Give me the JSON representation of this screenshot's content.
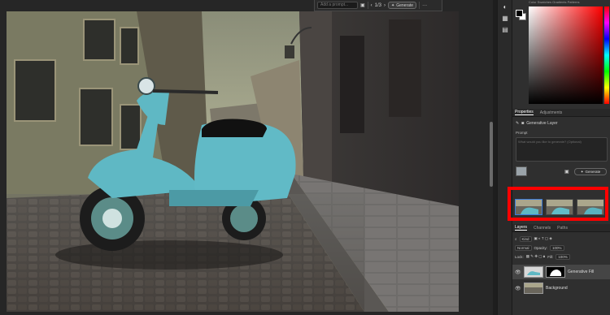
{
  "taskbar": {
    "prompt_placeholder": "Add a prompt...",
    "variation_counter": "1/3",
    "generate_label": "Generate",
    "more_label": "···"
  },
  "color_panel": {
    "tabs": "Color   Swatches   Gradients   Patterns",
    "foreground": "#000000",
    "background": "#ffffff"
  },
  "properties_panel": {
    "tabs": [
      "Properties",
      "Adjustments"
    ],
    "layer_type": "Generative Layer",
    "prompt_label": "Prompt",
    "prompt_placeholder": "What would you like to generate? (Optional)",
    "generate_label": "Generate"
  },
  "layers_panel": {
    "tabs": [
      "Layers",
      "Channels",
      "Paths"
    ],
    "filter_label": "Kind",
    "blend_mode": "Normal",
    "opacity_label": "Opacity:",
    "opacity_value": "100%",
    "lock_label": "Lock:",
    "fill_label": "Fill:",
    "fill_value": "100%",
    "layers": [
      {
        "name": "Generative Fill",
        "selected": true
      },
      {
        "name": "Background",
        "selected": false
      }
    ]
  },
  "highlight_color": "#ff0000"
}
